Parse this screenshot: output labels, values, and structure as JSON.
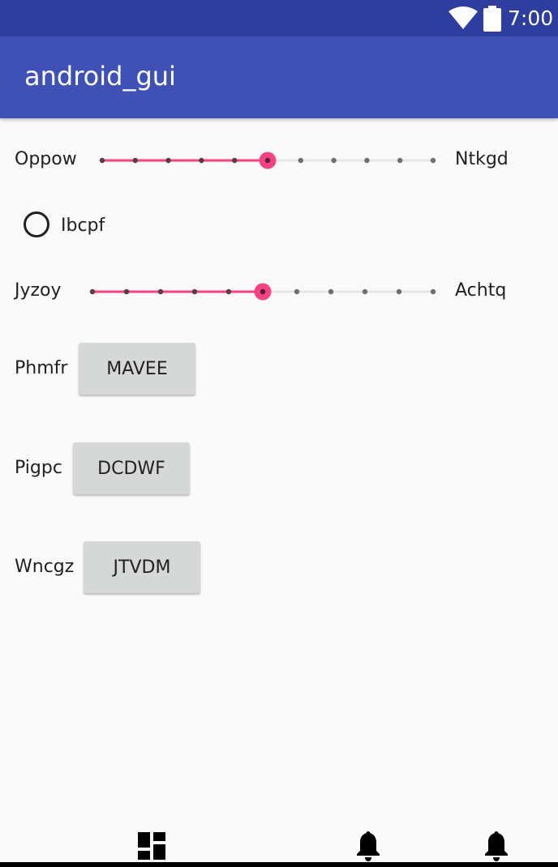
{
  "status_bar": {
    "time": "7:00",
    "icons": [
      "wifi-icon",
      "battery-icon"
    ]
  },
  "app_bar": {
    "title": "android_gui"
  },
  "slider_1": {
    "left_label": "Oppow",
    "right_label": "Ntkgd",
    "value": 5,
    "max": 10,
    "accent": "#f44382"
  },
  "radio": {
    "label": "Ibcpf",
    "checked": false
  },
  "slider_2": {
    "left_label": "Jyzoy",
    "right_label": "Achtq",
    "value": 5,
    "max": 10,
    "accent": "#f44382"
  },
  "rows": [
    {
      "label": "Phmfr",
      "button": "MAVEE"
    },
    {
      "label": "Pigpc",
      "button": "DCDWF"
    },
    {
      "label": "Wncgz",
      "button": "JTVDM"
    }
  ],
  "bottom_nav": {
    "icons": [
      "dashboard-icon",
      "notifications-icon",
      "notifications-icon"
    ]
  },
  "colors": {
    "status_bar": "#2f3e9e",
    "app_bar": "#3f51b5",
    "accent": "#f44382",
    "button_bg": "#d6d7d7",
    "background": "#fafafa"
  }
}
